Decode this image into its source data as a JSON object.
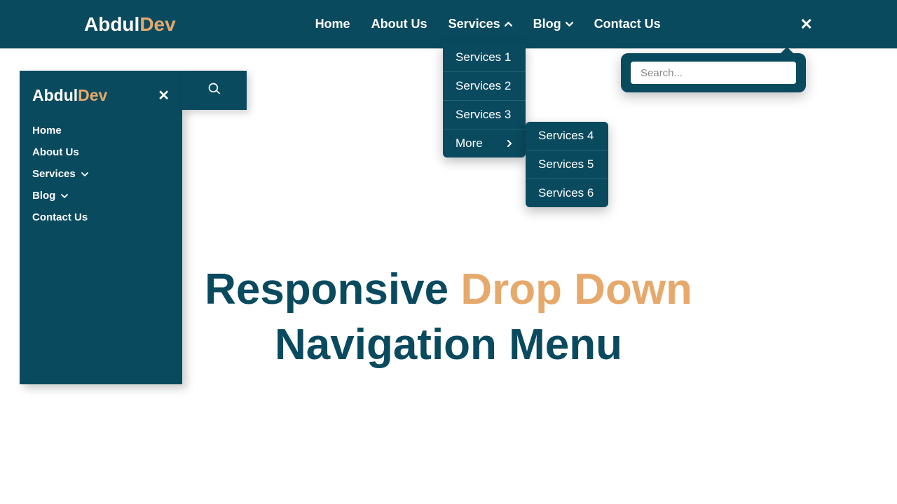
{
  "brand": {
    "part1": "Abdul",
    "part2": "Dev"
  },
  "topnav": {
    "home": "Home",
    "about": "About Us",
    "services": "Services",
    "blog": "Blog",
    "contact": "Contact Us"
  },
  "dropdown": {
    "items": [
      "Services 1",
      "Services 2",
      "Services 3"
    ],
    "more_label": "More"
  },
  "submenu": {
    "items": [
      "Services 4",
      "Services 5",
      "Services 6"
    ]
  },
  "search": {
    "placeholder": "Search..."
  },
  "mobile": {
    "items": [
      "Home",
      "About Us",
      "Services",
      "Blog",
      "Contact Us"
    ]
  },
  "hero": {
    "part1": "Responsive ",
    "part2": "Drop Down",
    "part3": "Navigation Menu"
  }
}
